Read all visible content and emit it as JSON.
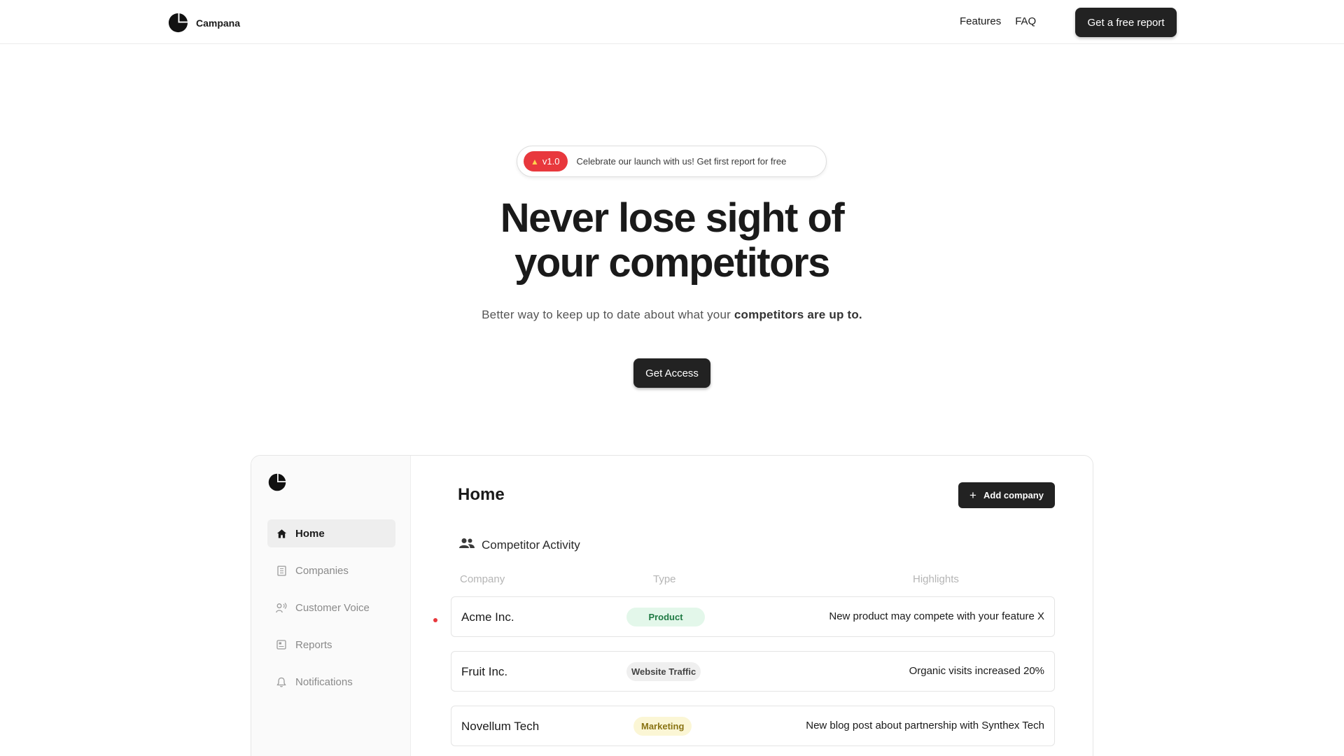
{
  "nav": {
    "brand": "Campana",
    "links": [
      "Features",
      "FAQ"
    ],
    "cta": "Get a free report"
  },
  "hero": {
    "badge": "v1.0",
    "announcement": "Celebrate our launch with us! Get first report for free",
    "title_line1": "Never lose sight of",
    "title_line2": "your competitors",
    "subtitle_plain": "Better way to keep up to date about what your ",
    "subtitle_bold": "competitors are up to.",
    "cta": "Get Access"
  },
  "app": {
    "sidebar": {
      "items": [
        {
          "label": "Home",
          "icon": "home-icon",
          "active": true
        },
        {
          "label": "Companies",
          "icon": "building-icon",
          "active": false
        },
        {
          "label": "Customer Voice",
          "icon": "voice-icon",
          "active": false
        },
        {
          "label": "Reports",
          "icon": "report-icon",
          "active": false
        },
        {
          "label": "Notifications",
          "icon": "bell-icon",
          "active": false
        }
      ]
    },
    "page_title": "Home",
    "add_button": "Add company",
    "section_title": "Competitor Activity",
    "columns": [
      "Company",
      "Type",
      "Highlights"
    ],
    "rows": [
      {
        "company": "Acme Inc.",
        "type": "Product",
        "highlight": "New product may compete with your feature X",
        "unread": true
      },
      {
        "company": "Fruit Inc.",
        "type": "Website Traffic",
        "highlight": "Organic visits increased 20%",
        "unread": false
      },
      {
        "company": "Novellum Tech",
        "type": "Marketing",
        "highlight": "New blog post about partnership with Synthex Tech",
        "unread": false
      }
    ],
    "tag_colors": {
      "Product": {
        "bg": "#e3f7ea",
        "fg": "#1f7a43"
      },
      "Website Traffic": {
        "bg": "#efefef",
        "fg": "#444444"
      },
      "Marketing": {
        "bg": "#fbf6d5",
        "fg": "#8a7414"
      }
    },
    "unread_color": "#e8383d"
  }
}
